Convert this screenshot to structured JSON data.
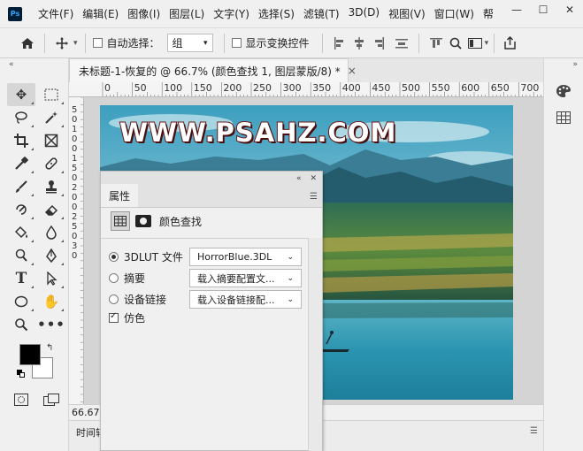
{
  "menu": {
    "logo": "Ps",
    "items": [
      "文件(F)",
      "编辑(E)",
      "图像(I)",
      "图层(L)",
      "文字(Y)",
      "选择(S)",
      "滤镜(T)",
      "3D(D)",
      "视图(V)",
      "窗口(W)",
      "帮"
    ],
    "window": {
      "minimize": "—",
      "maximize": "☐",
      "close": "✕"
    }
  },
  "options": {
    "auto_select_label": "自动选择：",
    "auto_select_value": "组",
    "show_transform_label": "显示变换控件"
  },
  "document": {
    "tab_title": "未标题-1-恢复的 @ 66.7% (颜色查找 1, 图层蒙版/8) *",
    "tab_close": "×",
    "zoom": "66.67",
    "timeline_label": "时间轴",
    "ruler_h": [
      "0",
      "50",
      "100",
      "150",
      "200",
      "250",
      "300",
      "350",
      "400",
      "450",
      "500",
      "550",
      "600",
      "650",
      "700"
    ],
    "ruler_v": [
      "5",
      "0",
      "1",
      "0",
      "0",
      "1",
      "5",
      "0",
      "2",
      "0",
      "0",
      "2",
      "5",
      "0",
      "3",
      "0"
    ]
  },
  "image": {
    "watermark": "WWW.PSAHZ.COM"
  },
  "properties": {
    "tab_label": "属性",
    "title": "颜色查找",
    "rows": [
      {
        "label": "3DLUT 文件",
        "value": "HorrorBlue.3DL",
        "selected": true
      },
      {
        "label": "摘要",
        "value": "载入摘要配置文...",
        "selected": false
      },
      {
        "label": "设备链接",
        "value": "载入设备链接配...",
        "selected": false
      }
    ],
    "dither_label": "仿色",
    "dither_checked": true
  },
  "colors": {
    "foreground": "#000000",
    "background": "#ffffff",
    "accent": "#31a8ff"
  }
}
